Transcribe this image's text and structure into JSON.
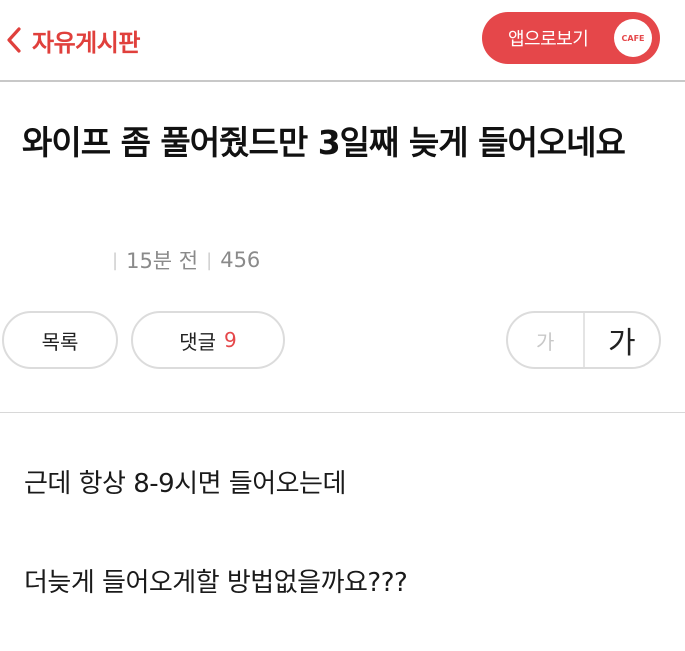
{
  "header": {
    "board_name": "자유게시판",
    "app_button_label": "앱으로보기",
    "cafe_badge": "CAFE",
    "back_icon": "chevron-left-icon",
    "accent_color": "#e5474a"
  },
  "post": {
    "title": "와이프 좀 풀어줬드만 3일째 늦게 들어오네요",
    "time": "15분 전",
    "views": "456"
  },
  "actions": {
    "list_label": "목록",
    "comment_label": "댓글",
    "comment_count": "9",
    "font_small": "가",
    "font_large": "가"
  },
  "content": {
    "lines": [
      "근데 항상 8-9시면 들어오는데",
      "더늦게 들어오게할 방법없을까요???"
    ]
  }
}
